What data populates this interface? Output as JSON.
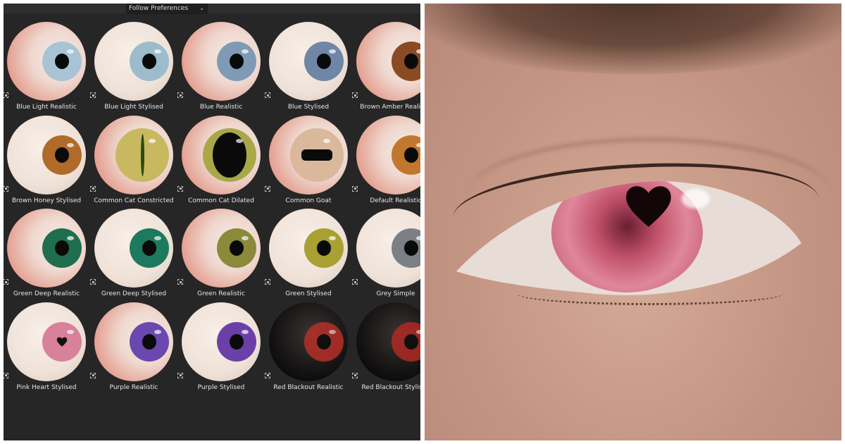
{
  "panel": {
    "dropdown_label": "Follow Preferences",
    "dropdown_icon": "chevron-down-icon"
  },
  "presets": [
    {
      "label": "Blue Light Realistic",
      "type": "realistic",
      "iris_color": "#a8c4d4",
      "pupil": "round"
    },
    {
      "label": "Blue Light Stylised",
      "type": "stylised",
      "iris_color": "#9cbccc",
      "pupil": "round"
    },
    {
      "label": "Blue Realistic",
      "type": "realistic",
      "iris_color": "#7f9ab5",
      "pupil": "round"
    },
    {
      "label": "Blue Stylised",
      "type": "stylised",
      "iris_color": "#6f86a6",
      "pupil": "round"
    },
    {
      "label": "Brown Amber Realistic",
      "type": "realistic",
      "iris_color": "#8a4a24",
      "pupil": "round"
    },
    {
      "label": "Brown Honey Stylised",
      "type": "stylised",
      "iris_color": "#b06a2a",
      "pupil": "round"
    },
    {
      "label": "Common Cat Constricted",
      "type": "realistic",
      "iris_color": "#c8b860",
      "pupil": "slit"
    },
    {
      "label": "Common Cat Dilated",
      "type": "realistic",
      "iris_color": "#a8a848",
      "pupil": "dilated"
    },
    {
      "label": "Common Goat",
      "type": "realistic",
      "iris_color": "#d9b89c",
      "pupil": "horizontal"
    },
    {
      "label": "Default Realistic",
      "type": "realistic",
      "iris_color": "#c2772e",
      "pupil": "round"
    },
    {
      "label": "Green Deep Realistic",
      "type": "realistic",
      "iris_color": "#1f6e50",
      "pupil": "round"
    },
    {
      "label": "Green Deep Stylised",
      "type": "stylised",
      "iris_color": "#1e7a5e",
      "pupil": "round"
    },
    {
      "label": "Green Realistic",
      "type": "realistic",
      "iris_color": "#8a8a3a",
      "pupil": "round"
    },
    {
      "label": "Green Stylised",
      "type": "stylised",
      "iris_color": "#a8a032",
      "pupil": "round"
    },
    {
      "label": "Grey Simple",
      "type": "stylised",
      "iris_color": "#7c8084",
      "pupil": "round"
    },
    {
      "label": "Pink Heart Stylised",
      "type": "stylised",
      "iris_color": "#d9809a",
      "pupil": "heart"
    },
    {
      "label": "Purple Realistic",
      "type": "realistic",
      "iris_color": "#6a48b0",
      "pupil": "round"
    },
    {
      "label": "Purple Stylised",
      "type": "stylised",
      "iris_color": "#6a40a8",
      "pupil": "round"
    },
    {
      "label": "Red Blackout Realistic",
      "type": "blackout",
      "iris_color": "#c03028",
      "pupil": "round"
    },
    {
      "label": "Red Blackout Stylised",
      "type": "blackout",
      "iris_color": "#b82a24",
      "pupil": "round"
    }
  ],
  "preview": {
    "iris_color": "#d9809a",
    "pupil": "heart"
  }
}
